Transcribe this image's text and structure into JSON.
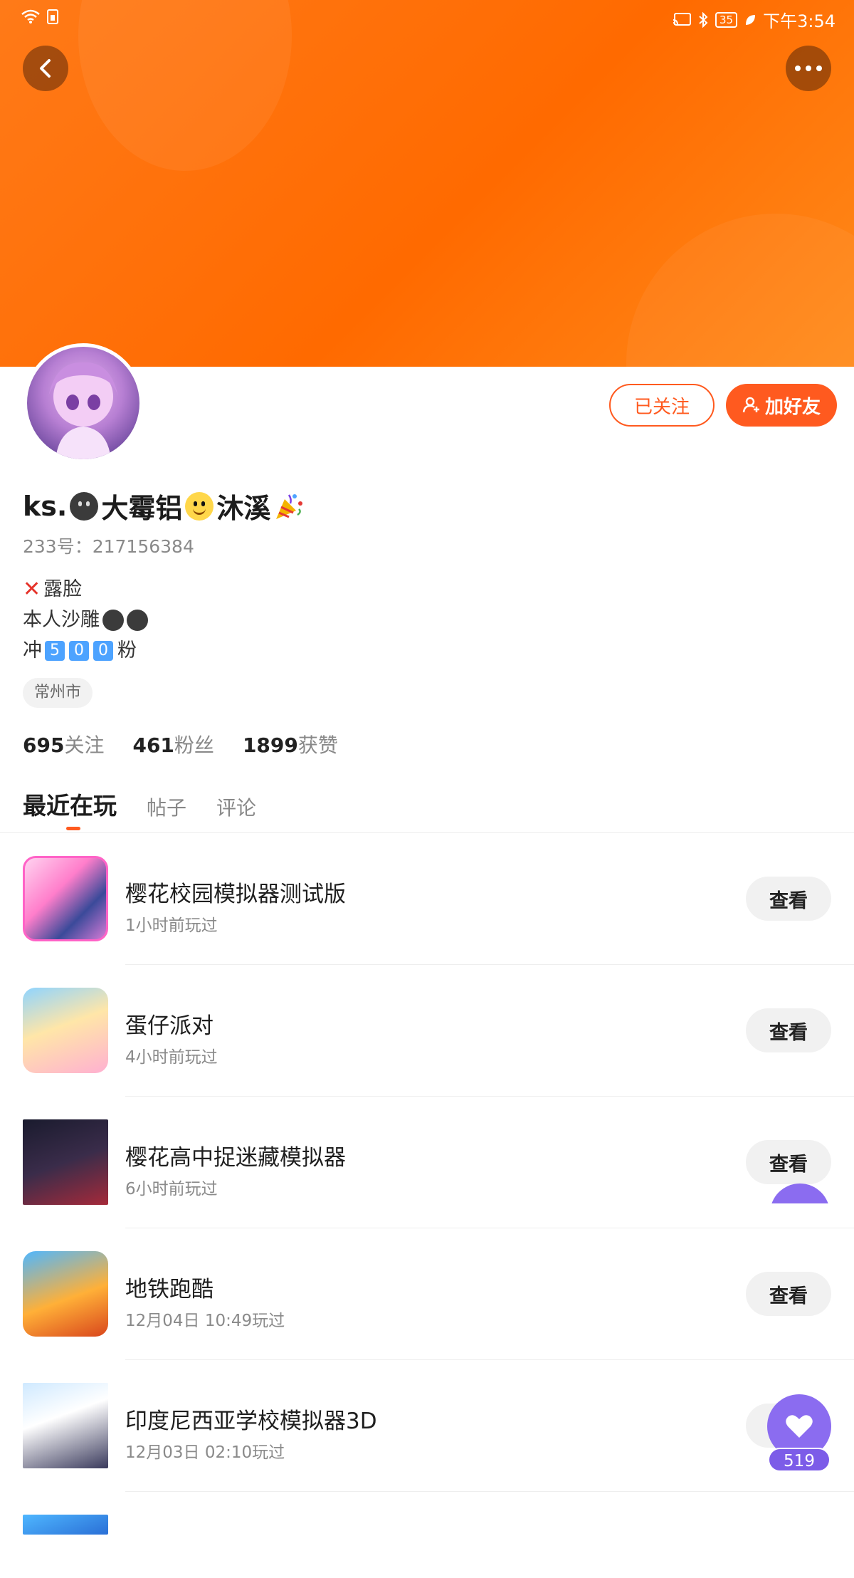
{
  "status": {
    "time": "下午3:54",
    "battery": "35"
  },
  "profile": {
    "name_part1": "ks.",
    "name_part2": "大霉铝",
    "name_part3": "沐溪",
    "uid": "233号：217156384",
    "bio": {
      "line1": "露脸",
      "line2": "本人沙雕",
      "line3_prefix": "冲 ",
      "line3_digits": [
        "5",
        "0",
        "0"
      ],
      "line3_suffix": "粉"
    },
    "city": "常州市",
    "stats": [
      {
        "num": "695",
        "label": "关注"
      },
      {
        "num": "461",
        "label": "粉丝"
      },
      {
        "num": "1899",
        "label": "获赞"
      }
    ]
  },
  "actions": {
    "follow": "已关注",
    "add_friend": "加好友"
  },
  "tabs": [
    "最近在玩",
    "帖子",
    "评论"
  ],
  "games": [
    {
      "title": "樱花校园模拟器测试版",
      "time": "1小时前玩过",
      "button": "查看"
    },
    {
      "title": "蛋仔派对",
      "time": "4小时前玩过",
      "button": "查看"
    },
    {
      "title": "樱花高中捉迷藏模拟器",
      "time": "6小时前玩过",
      "button": "查看"
    },
    {
      "title": "地铁跑酷",
      "time": "12月04日 10:49玩过",
      "button": "查看"
    },
    {
      "title": "印度尼西亚学校模拟器3D",
      "time": "12月03日 02:10玩过",
      "button": "查看"
    }
  ],
  "likes": {
    "count": "519"
  },
  "colors": {
    "accent": "#ff5a1f",
    "banner": "#ff7a18",
    "like_button": "#8b6cf0"
  }
}
